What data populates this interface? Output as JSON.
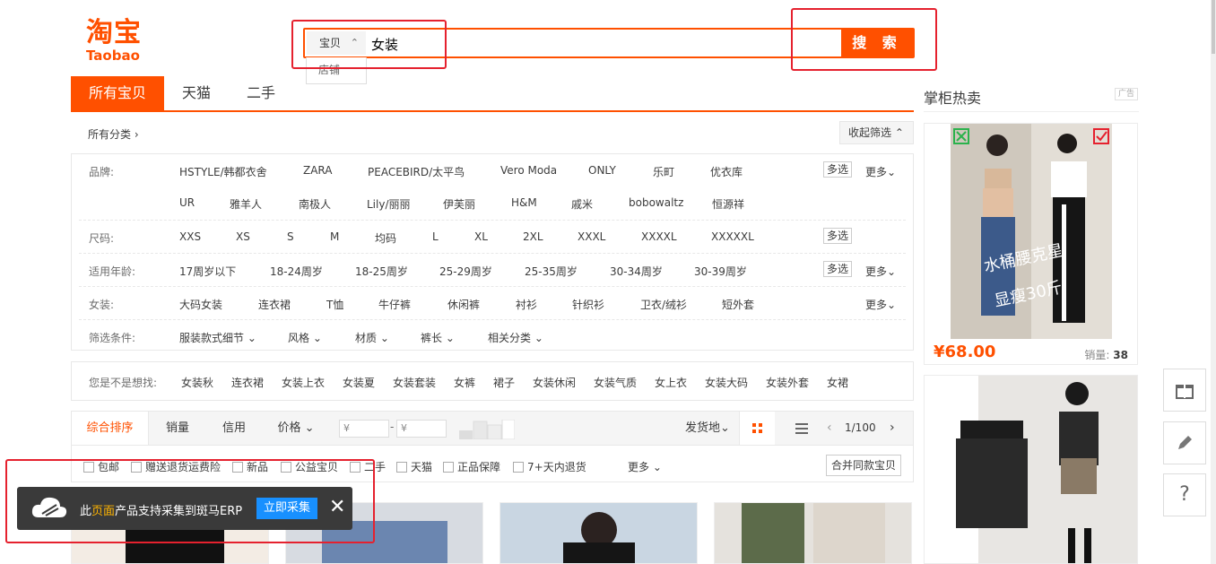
{
  "logo": {
    "cn": "淘宝",
    "en": "Taobao"
  },
  "search": {
    "type_selected": "宝贝",
    "type_other": "店铺",
    "value": "女装",
    "button": "搜 索"
  },
  "tabs": [
    "所有宝贝",
    "天猫",
    "二手"
  ],
  "hot": {
    "title": "掌柜热卖",
    "ad": "广告",
    "price": "¥68.00",
    "sales_label": "销量:",
    "sales_value": "38",
    "img_text_1": "水桶腰克星",
    "img_text_2": "显瘦30斤"
  },
  "filter": {
    "all_categories": "所有分类 ›",
    "collapse": "收起筛选 ⌃",
    "multi": "多选",
    "more": "更多⌄",
    "rows": [
      {
        "label": "品牌:",
        "items": [
          "HSTYLE/韩都衣舍",
          "ZARA",
          "PEACEBIRD/太平鸟",
          "Vero Moda",
          "ONLY",
          "乐町",
          "优衣库"
        ],
        "items2": [
          "UR",
          "雅羊人",
          "南极人",
          "Lily/丽丽",
          "伊芙丽",
          "H&M",
          "戚米",
          "bobowaltz",
          "恒源祥"
        ]
      },
      {
        "label": "尺码:",
        "items": [
          "XXS",
          "XS",
          "S",
          "M",
          "均码",
          "L",
          "XL",
          "2XL",
          "XXXL",
          "XXXXL",
          "XXXXXL"
        ]
      },
      {
        "label": "适用年龄:",
        "items": [
          "17周岁以下",
          "18-24周岁",
          "18-25周岁",
          "25-29周岁",
          "25-35周岁",
          "30-34周岁",
          "30-39周岁"
        ]
      },
      {
        "label": "女装:",
        "items": [
          "大码女装",
          "连衣裙",
          "T恤",
          "牛仔裤",
          "休闲裤",
          "衬衫",
          "针织衫",
          "卫衣/绒衫",
          "短外套"
        ]
      },
      {
        "label": "筛选条件:",
        "items": [
          "服装款式细节 ⌄",
          "风格 ⌄",
          "材质 ⌄",
          "裤长 ⌄",
          "相关分类 ⌄"
        ]
      }
    ]
  },
  "related": {
    "label": "您是不是想找:",
    "items": [
      "女装秋",
      "连衣裙",
      "女装上衣",
      "女装夏",
      "女装套装",
      "女裤",
      "裙子",
      "女装休闲",
      "女装气质",
      "女上衣",
      "女装大码",
      "女装外套",
      "女裙"
    ]
  },
  "sortbar": {
    "items": [
      "综合排序",
      "销量",
      "信用",
      "价格 ⌄"
    ],
    "price_from": "¥",
    "price_to": "¥",
    "dash": "-",
    "ship": "发货地⌄",
    "page": "1/100"
  },
  "options": {
    "items": [
      "包邮",
      "赠送退货运费险",
      "新品",
      "公益宝贝",
      "二手",
      "天猫",
      "正品保障",
      "7+天内退货"
    ],
    "more": "更多 ⌄",
    "merge": "合并同款宝贝"
  },
  "collect": {
    "pre": "此",
    "em": "页面",
    "post": "产品支持采集到斑马ERP",
    "go": "立即采集",
    "close": "✕"
  },
  "tools": {
    "help": "?"
  }
}
